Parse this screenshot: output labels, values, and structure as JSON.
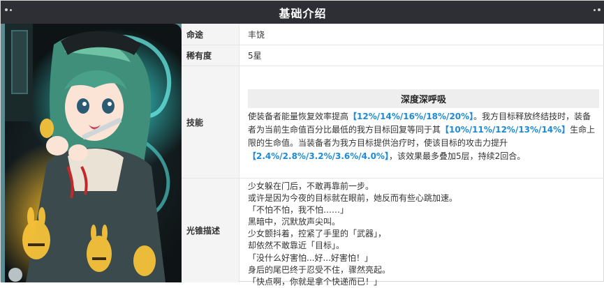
{
  "header": {
    "title": "基础介绍"
  },
  "rows": {
    "fate": {
      "label": "命途",
      "value": "丰饶"
    },
    "rarity": {
      "label": "稀有度",
      "value": "5星"
    },
    "skill": {
      "label": "技能",
      "name": "深度深呼吸",
      "text_1": "使装备者能量恢复效率提高",
      "hl_1": "【12%/14%/16%/18%/20%】",
      "text_2": "。我方目标释放终结技时，装备者为当前生命值百分比最低的我方目标回复等同于其",
      "hl_2": "【10%/11%/12%/13%/14%】",
      "text_3": "生命上限的生命值。当装备者为我方目标提供治疗时，使该目标的攻击力提升",
      "hl_3": "【2.4%/2.8%/3.2%/3.6%/4.0%】",
      "text_4": "，该效果最多叠加5层，持续2回合。"
    },
    "description": {
      "label": "光锥描述",
      "lines": [
        "少女躲在门后，不敢再靠前一步。",
        "或许是因为今夜的目标就在眼前，她反而有些心跳加速。",
        "「不怕不怕，我不怕……」",
        "黑暗中，沉默放声尖叫。",
        "少女颤抖着，控紧了手里的「武器」，",
        "却依然不敢靠近「目标」。",
        "「没什么好害怕...好...好害怕！」",
        "身后的尾巴终于忍受不住，骤然亮起。",
        "「快点啊，你就是拿个快递而已！」"
      ]
    }
  },
  "image": {
    "subject": "light-cone-character-art"
  },
  "colors": {
    "header_bg": "#2e2f35",
    "highlight": "#1e8ad6",
    "label_bg": "#f4f4f4"
  }
}
